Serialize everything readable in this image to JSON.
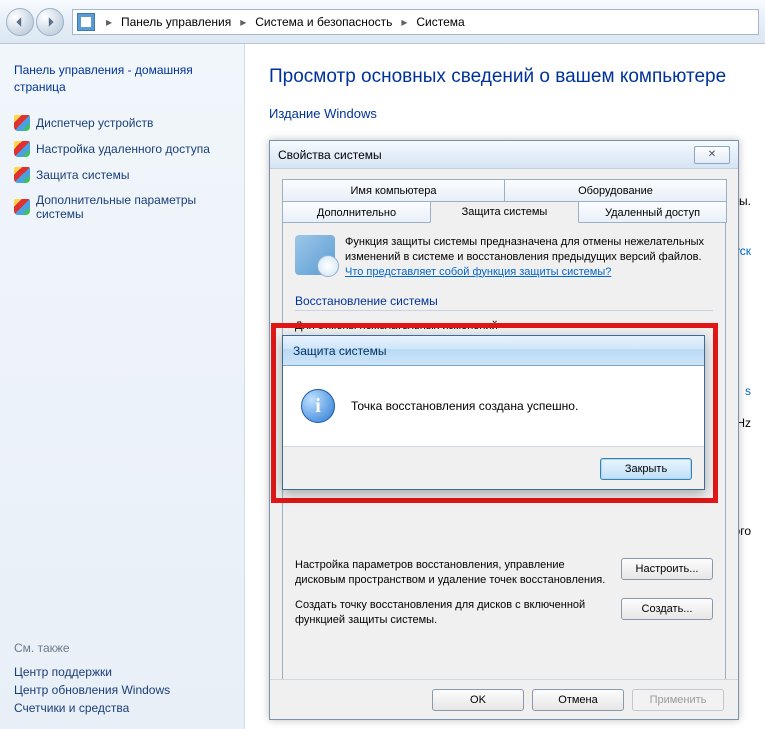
{
  "breadcrumb": {
    "items": [
      "Панель управления",
      "Система и безопасность",
      "Система"
    ]
  },
  "sidebar": {
    "heading": "Панель управления - домашняя страница",
    "links": [
      "Диспетчер устройств",
      "Настройка удаленного доступа",
      "Защита системы",
      "Дополнительные параметры системы"
    ],
    "see_also_heading": "См. также",
    "see_also": [
      "Центр поддержки",
      "Центр обновления Windows",
      "Счетчики и средства"
    ]
  },
  "content": {
    "title": "Просмотр основных сведений о вашем компьютере",
    "edition_label": "Издание Windows",
    "frag_ены": "ены.",
    "frag_уск": "уск",
    "frag_s": "s",
    "frag_ghz": "GHz",
    "frag_ого": "ого"
  },
  "sysprop": {
    "title": "Свойства системы",
    "tabs_row1": [
      "Имя компьютера",
      "Оборудование"
    ],
    "tabs_row2": [
      "Дополнительно",
      "Защита системы",
      "Удаленный доступ"
    ],
    "desc": "Функция защиты системы предназначена для отмены нежелательных изменений в системе и восстановления предыдущих версий файлов. ",
    "desc_link": "Что представляет собой функция защиты системы?",
    "group1_legend": "Восстановление системы",
    "group1_line1": "Для отмены нежелательных изменений",
    "cfg_text": "Настройка параметров восстановления, управление дисковым пространством и удаление точек восстановления.",
    "cfg_btn": "Настроить...",
    "create_text": "Создать точку восстановления для дисков с включенной функцией защиты системы.",
    "create_btn": "Создать...",
    "ok": "OK",
    "cancel": "Отмена",
    "apply": "Применить"
  },
  "msg": {
    "title": "Защита системы",
    "text": "Точка восстановления создана успешно.",
    "close": "Закрыть"
  }
}
